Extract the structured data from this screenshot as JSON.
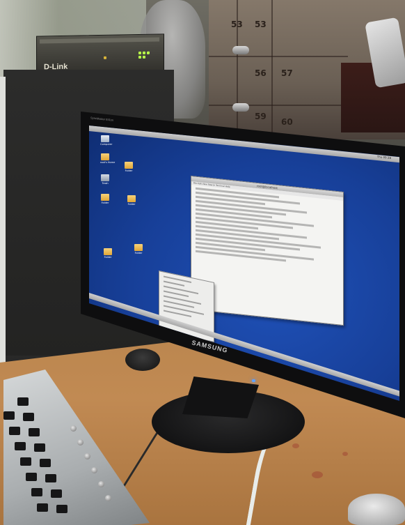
{
  "router": {
    "brand": "D-Link"
  },
  "cabinet": {
    "numbers": [
      "53",
      "53",
      "56",
      "57",
      "59",
      "60"
    ]
  },
  "monitor": {
    "brand": "SAMSUNG",
    "model_label": "SyncMaster 931sn"
  },
  "screen": {
    "clock": "Thu 09:38",
    "terminal_title": "root@localhost",
    "terminal_menu": "File  Edit  View  Search  Terminal  Help",
    "desktop_icons": [
      {
        "icon": "computer-icon",
        "label": "Computer"
      },
      {
        "icon": "folder-icon",
        "label": "root's Home"
      },
      {
        "icon": "trash-icon",
        "label": "Trash"
      },
      {
        "icon": "folder-icon",
        "label": "Folder"
      },
      {
        "icon": "folder-icon",
        "label": "Folder"
      },
      {
        "icon": "folder-icon",
        "label": "Folder"
      },
      {
        "icon": "folder-icon",
        "label": "Folder"
      },
      {
        "icon": "folder-icon",
        "label": "Folder"
      }
    ]
  },
  "colors": {
    "desktop_background": "#1f51b8",
    "desk_wood": "#c18a53",
    "power_led": "#5fa2ff"
  }
}
